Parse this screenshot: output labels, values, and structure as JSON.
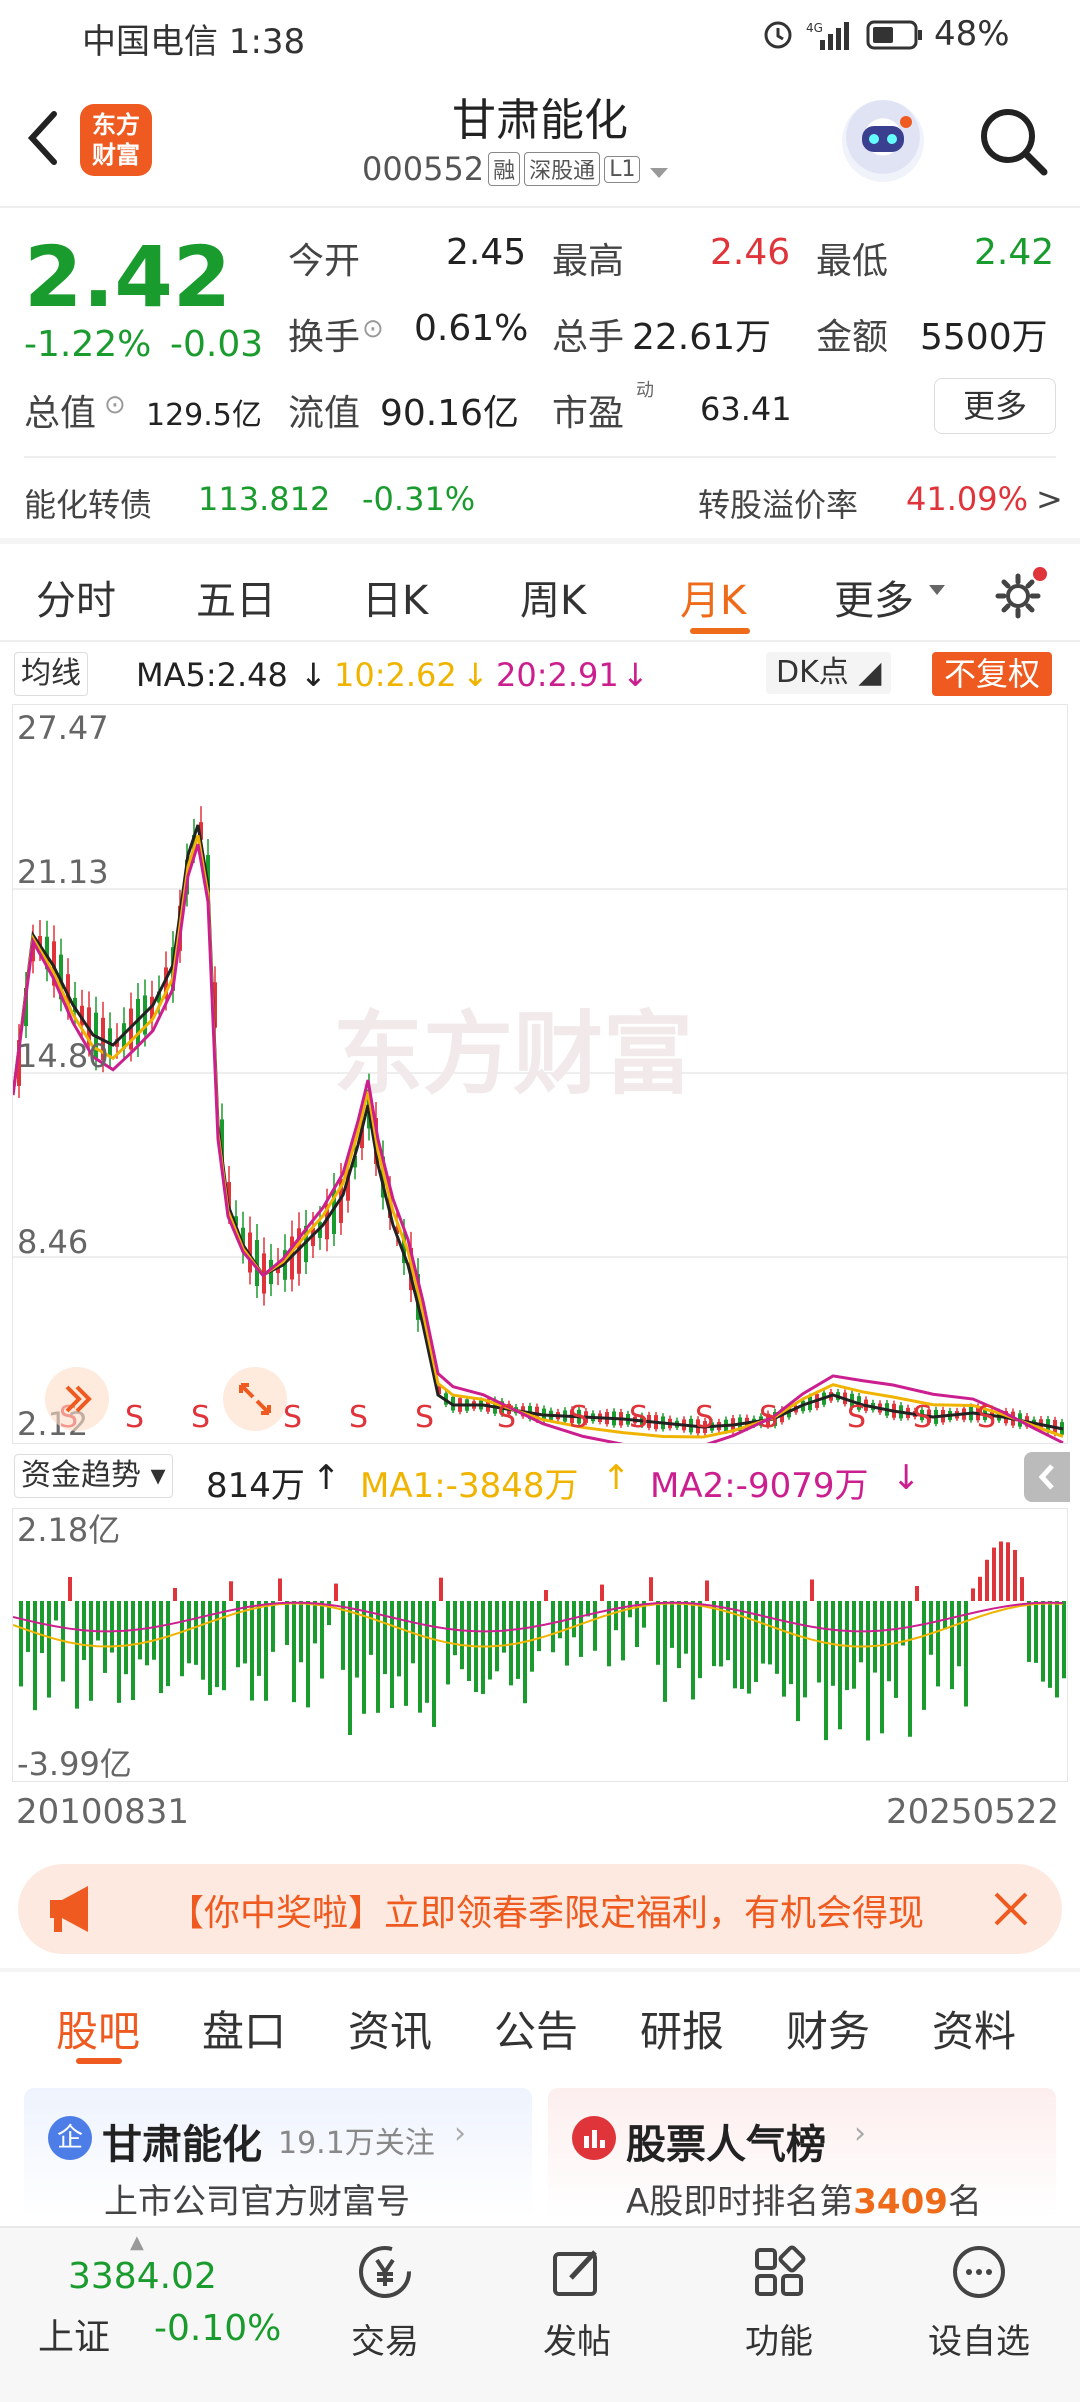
{
  "status_bar": {
    "carrier_time": "中国电信 1:38",
    "battery": "48%"
  },
  "header": {
    "stock_name": "甘肃能化",
    "code": "000552",
    "tag_rong": "融",
    "tag_sgt": "深股通",
    "tag_l1": "L1"
  },
  "quote": {
    "price": "2.42",
    "change_pct": "-1.22%",
    "change_val": "-0.03",
    "open_label": "今开",
    "open": "2.45",
    "high_label": "最高",
    "high": "2.46",
    "low_label": "最低",
    "low": "2.42",
    "turnover_label": "换手",
    "turnover": "0.61%",
    "vol_label": "总手",
    "vol": "22.61万",
    "amount_label": "金额",
    "amount": "5500万",
    "mcap_label": "总值",
    "mcap": "129.5亿",
    "float_label": "流值",
    "float": "90.16亿",
    "pe_label": "市盈",
    "pe_sup": "动",
    "pe": "63.41",
    "more_button": "更多"
  },
  "bond": {
    "name": "能化转债",
    "price": "113.812",
    "change": "-0.31%",
    "premium_label": "转股溢价率",
    "premium": "41.09%",
    "arrow": ">"
  },
  "kline_tabs": [
    "分时",
    "五日",
    "日K",
    "周K",
    "月K",
    "更多"
  ],
  "kline_active": "月K",
  "ma_legend": {
    "type": "均线",
    "ma5": "MA5:2.48",
    "ma10": "10:2.62",
    "ma20": "20:2.91",
    "dk": "DK点",
    "adjust": "不复权"
  },
  "price_axis": [
    "27.47",
    "21.13",
    "14.80",
    "8.46",
    "2.12"
  ],
  "watermark": "东方财富",
  "sell_marker": "S",
  "fund_legend": {
    "type": "资金趋势",
    "value": "814万",
    "ma1": "MA1:-3848万",
    "ma2": "MA2:-9079万"
  },
  "fund_axis": {
    "top": "2.18亿",
    "bottom": "-3.99亿"
  },
  "date_range": {
    "start": "20100831",
    "end": "20250522"
  },
  "banner": {
    "text": "【你中奖啦】立即领春季限定福利，有机会得现"
  },
  "section_tabs": [
    "股吧",
    "盘口",
    "资讯",
    "公告",
    "研报",
    "财务",
    "资料"
  ],
  "section_active": "股吧",
  "cards": {
    "left_title": "甘肃能化",
    "left_follow": "19.1万关注",
    "left_sub": "上市公司官方财富号",
    "right_title": "股票人气榜",
    "right_sub_pre": "A股即时排名第",
    "right_rank": "3409",
    "right_sub_post": "名"
  },
  "bottom_bar": {
    "index_value": "3384.02",
    "index_name": "上证",
    "index_change": "-0.10%",
    "trade": "交易",
    "post": "发帖",
    "func": "功能",
    "watch": "设自选"
  },
  "colors": {
    "red": "#e0343b",
    "green": "#1a9b2e",
    "accent": "#ee6b1a",
    "ma10": "#f0b400",
    "ma20": "#cc1f8f"
  }
}
